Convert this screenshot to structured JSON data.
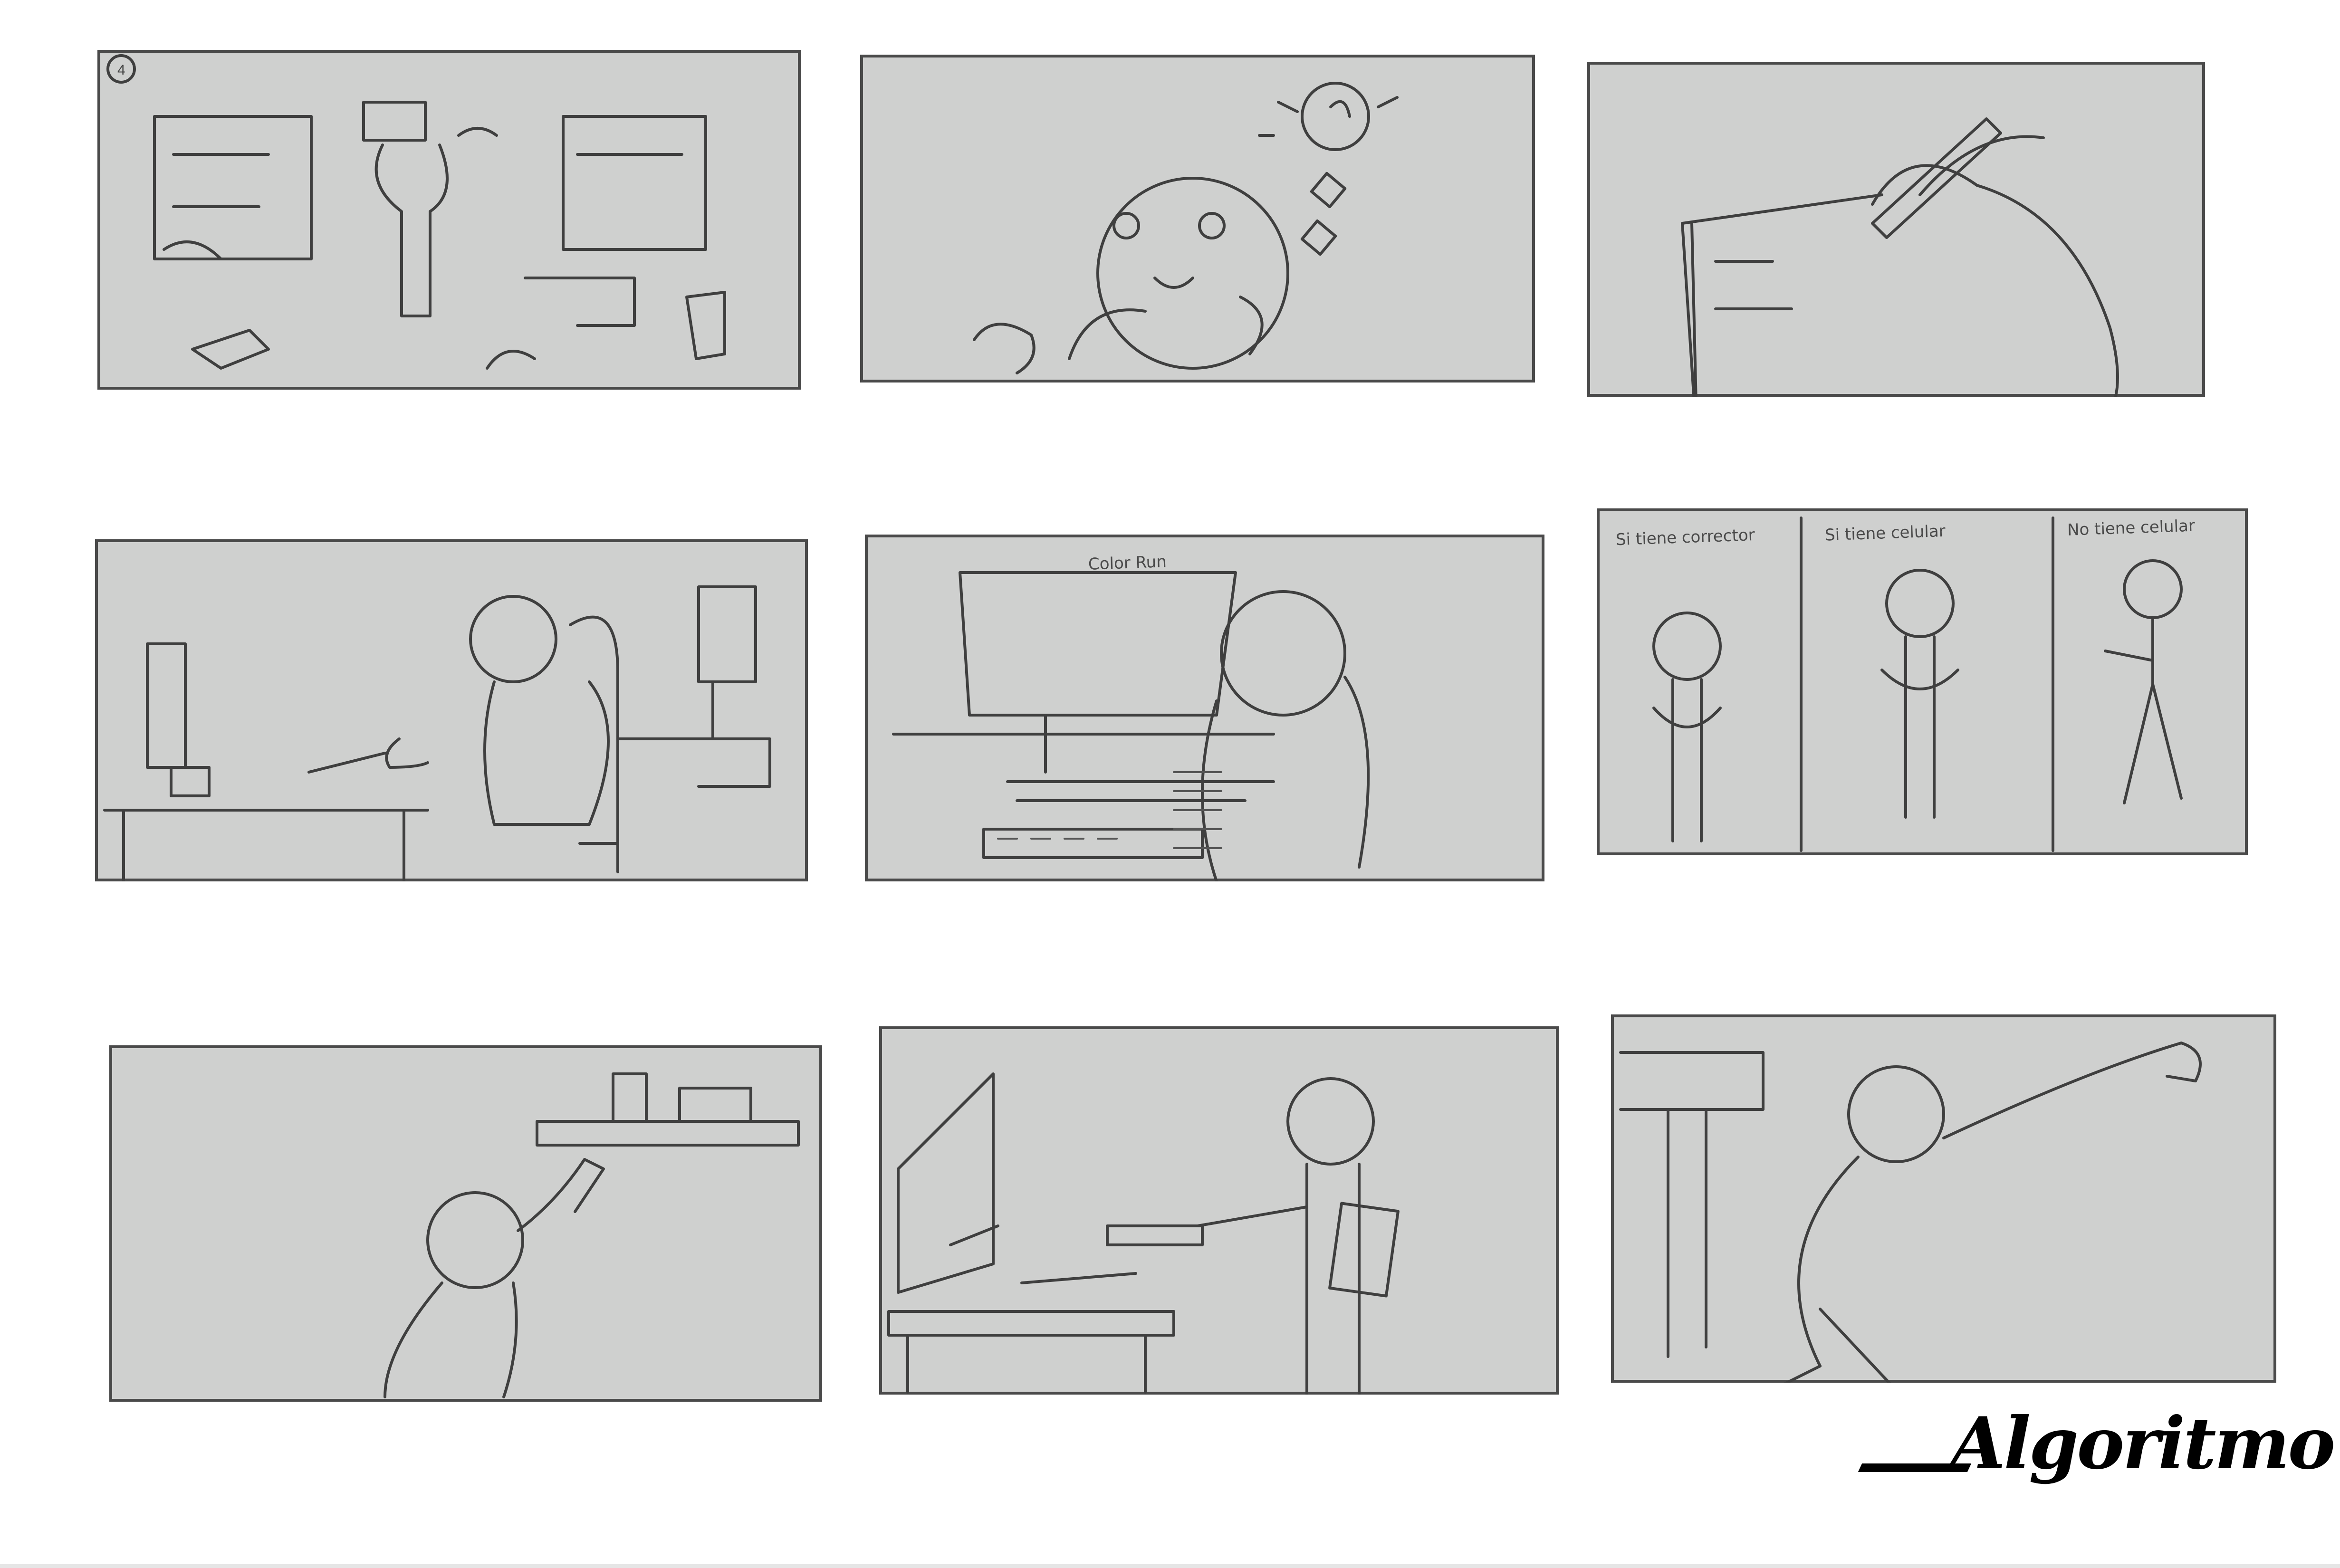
{
  "board": {
    "panels": [
      {
        "id": 1,
        "scene": "desk clutter with papers and shelves",
        "marker": "4"
      },
      {
        "id": 2,
        "scene": "character thinking with lightbulb idea"
      },
      {
        "id": 3,
        "scene": "hand writing list with pencil"
      },
      {
        "id": 4,
        "scene": "person at computer desk"
      },
      {
        "id": 5,
        "scene": "over-shoulder view of computer screen",
        "screen_text": "Color Run"
      },
      {
        "id": 6,
        "scene": "three options comparison",
        "captions": [
          "Si tiene corrector",
          "Si tiene celular",
          "No tiene celular"
        ]
      },
      {
        "id": 7,
        "scene": "person reaching to shelf"
      },
      {
        "id": 8,
        "scene": "person handing item at computer desk"
      },
      {
        "id": 9,
        "scene": "person running/throwing"
      }
    ]
  },
  "logo": {
    "text": "Algoritmo"
  },
  "colors": {
    "panel_bg": "#cfd0cf",
    "stroke": "#3f3f3f",
    "page_bg": "#ffffff"
  }
}
